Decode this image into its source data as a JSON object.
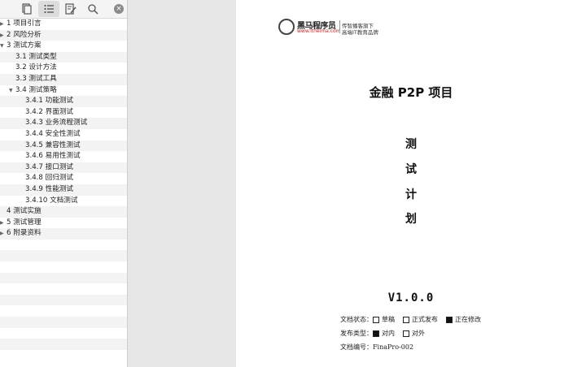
{
  "toolbar": {
    "buttons": [
      {
        "name": "thumbnails-button",
        "icon": "pages-icon"
      },
      {
        "name": "outline-button",
        "icon": "list-icon",
        "active": true
      },
      {
        "name": "annotations-button",
        "icon": "annotate-icon"
      },
      {
        "name": "search-button",
        "icon": "search-icon"
      }
    ],
    "clear_glyph": "×"
  },
  "outline": [
    {
      "label": "1 项目引言",
      "level": 0,
      "expand": "collapsed"
    },
    {
      "label": "2 风险分析",
      "level": 0,
      "expand": "collapsed"
    },
    {
      "label": "3 测试方案",
      "level": 0,
      "expand": "expanded"
    },
    {
      "label": "3.1 测试类型",
      "level": 1,
      "expand": "none"
    },
    {
      "label": "3.2 设计方法",
      "level": 1,
      "expand": "none"
    },
    {
      "label": "3.3 测试工具",
      "level": 1,
      "expand": "none"
    },
    {
      "label": "3.4 测试策略",
      "level": 1,
      "expand": "expanded"
    },
    {
      "label": "3.4.1 功能测试",
      "level": 2,
      "expand": "none"
    },
    {
      "label": "3.4.2 界面测试",
      "level": 2,
      "expand": "none"
    },
    {
      "label": "3.4.3 业务流程测试",
      "level": 2,
      "expand": "none"
    },
    {
      "label": "3.4.4 安全性测试",
      "level": 2,
      "expand": "none"
    },
    {
      "label": "3.4.5 兼容性测试",
      "level": 2,
      "expand": "none"
    },
    {
      "label": "3.4.6 易用性测试",
      "level": 2,
      "expand": "none"
    },
    {
      "label": "3.4.7 接口测试",
      "level": 2,
      "expand": "none"
    },
    {
      "label": "3.4.8 回归测试",
      "level": 2,
      "expand": "none"
    },
    {
      "label": "3.4.9 性能测试",
      "level": 2,
      "expand": "none"
    },
    {
      "label": "3.4.10 文档测试",
      "level": 2,
      "expand": "none"
    },
    {
      "label": "4 测试实施",
      "level": 0,
      "expand": "none"
    },
    {
      "label": "5 测试管理",
      "level": 0,
      "expand": "collapsed"
    },
    {
      "label": "6 附录资料",
      "level": 0,
      "expand": "collapsed"
    }
  ],
  "empty_rows": 11,
  "document": {
    "logo": {
      "name": "黑马程序员",
      "url": "www.itheima.com",
      "slogan_line1": "传智播客旗下",
      "slogan_line2": "高端IT教育品牌"
    },
    "title": "金融 P2P 项目",
    "vertical_title": [
      "测",
      "试",
      "计",
      "划"
    ],
    "version": "V1.0.0",
    "status_label": "文档状态：",
    "status_options": [
      {
        "label": "草稿",
        "checked": false
      },
      {
        "label": "正式发布",
        "checked": false
      },
      {
        "label": "正在修改",
        "checked": true
      }
    ],
    "publish_label": "发布类型：",
    "publish_options": [
      {
        "label": "对内",
        "checked": true
      },
      {
        "label": "对外",
        "checked": false
      }
    ],
    "number_label": "文档编号：",
    "number_value": "FinaPro-002"
  }
}
